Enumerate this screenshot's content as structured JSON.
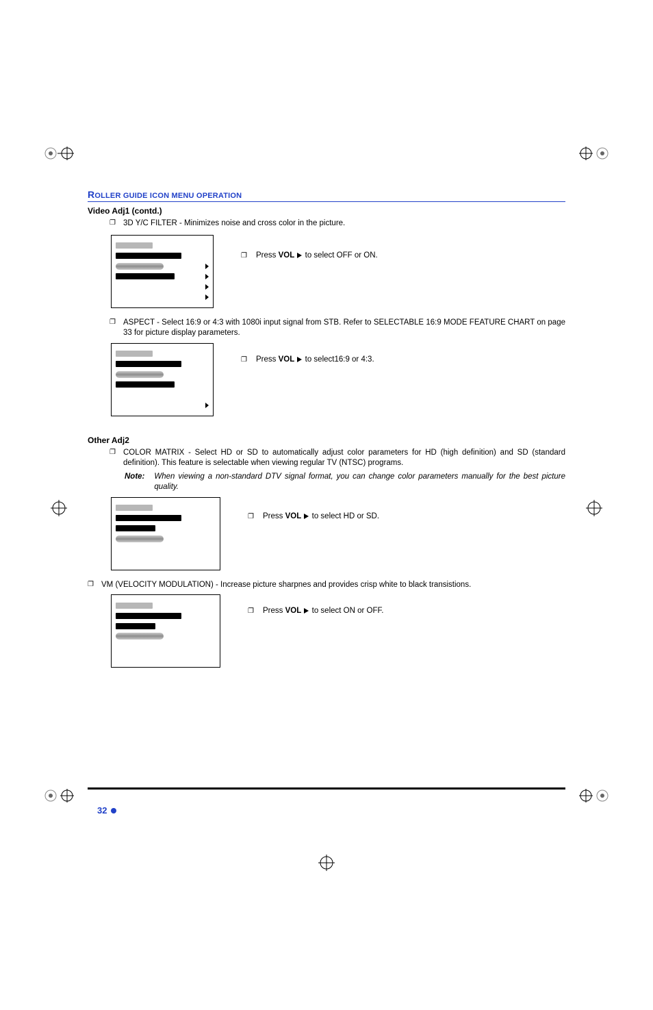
{
  "header": {
    "title_prefix": "R",
    "title_rest": "OLLER GUIDE ICON MENU OPERATION"
  },
  "videoAdj1": {
    "heading": "Video Adj1 (contd.)",
    "item3d": "3D Y/C FILTER - Minimizes noise and cross color in the picture.",
    "caption3d_pre": "Press ",
    "caption3d_bold": "VOL",
    "caption3d_post": " to select OFF or ON.",
    "aspect": "ASPECT - Select 16:9 or 4:3 with 1080i input signal from STB. Refer to SELECTABLE 16:9 MODE FEATURE CHART on page 33 for picture display parameters.",
    "captionAspect_pre": "Press ",
    "captionAspect_bold": "VOL",
    "captionAspect_post": " to select16:9 or 4:3."
  },
  "otherAdj2": {
    "heading": "Other Adj2",
    "colorMatrix": "COLOR MATRIX - Select HD or SD to automatically adjust color parameters for HD (high definition) and SD (standard definition). This feature is selectable when viewing regular TV (NTSC) programs.",
    "noteLabel": "Note:",
    "noteBody": "When viewing a non-standard DTV signal format, you can change color parameters manually for the best picture quality.",
    "captionCM_pre": "Press ",
    "captionCM_bold": "VOL",
    "captionCM_post": " to select HD or SD.",
    "vm": "VM (VELOCITY MODULATION) - Increase picture sharpnes and provides crisp white to black transistions.",
    "captionVM_pre": "Press ",
    "captionVM_bold": "VOL",
    "captionVM_post": " to select ON or OFF."
  },
  "footer": {
    "page": "32"
  }
}
